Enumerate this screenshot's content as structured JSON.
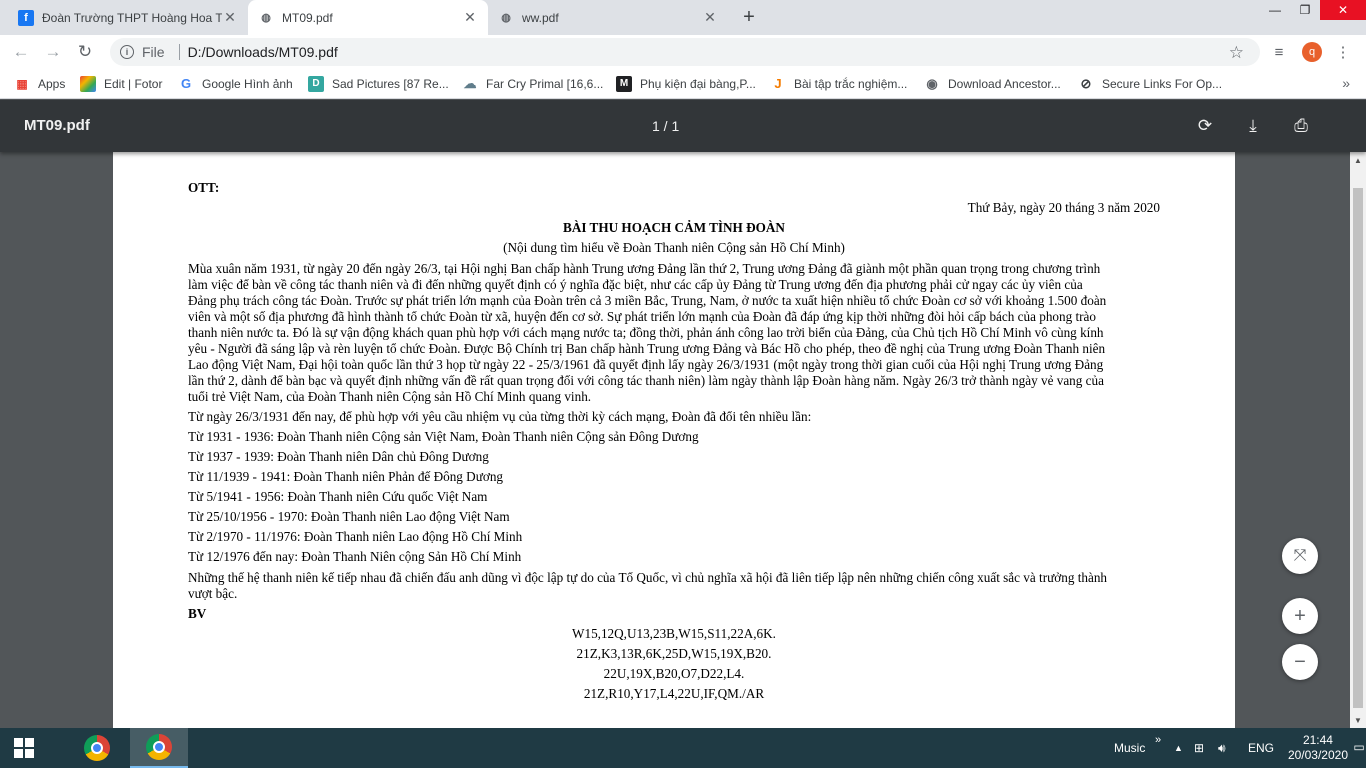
{
  "browser": {
    "tabs": [
      {
        "title": "Đoàn Trường THPT Hoàng Hoa Thám",
        "icon": "facebook-icon",
        "active": false
      },
      {
        "title": "MT09.pdf",
        "icon": "globe-icon",
        "active": true
      },
      {
        "title": "ww.pdf",
        "icon": "globe-icon",
        "active": false
      }
    ],
    "new_tab": "+",
    "window_controls": {
      "minimize": "—",
      "restore": "❐",
      "close": "✕"
    },
    "address": {
      "scheme": "File",
      "url": "D:/Downloads/MT09.pdf"
    },
    "profile_initial": "q"
  },
  "bookmarks": [
    {
      "label": "Apps",
      "icon": "apps-grid-icon",
      "color": "#e94235"
    },
    {
      "label": "Edit | Fotor",
      "icon": "fotor-icon",
      "color": "#f4b400"
    },
    {
      "label": "Google Hình ảnh",
      "icon": "google-icon",
      "color": "#4285f4"
    },
    {
      "label": "Sad Pictures [87 Re...",
      "icon": "bookmark-d-icon",
      "color": "#34a7a0"
    },
    {
      "label": "Far Cry Primal [16,6...",
      "icon": "bookmark-cloud-icon",
      "color": "#607d8b"
    },
    {
      "label": "Phụ kiện đại bàng,P...",
      "icon": "bookmark-m-icon",
      "color": "#202124"
    },
    {
      "label": "Bài tập trắc nghiệm...",
      "icon": "bookmark-j-icon",
      "color": "#f57c00"
    },
    {
      "label": "Download Ancestor...",
      "icon": "bookmark-globe-icon",
      "color": "#5f6368"
    },
    {
      "label": "Secure Links For Op...",
      "icon": "bookmark-link-icon",
      "color": "#3c4043"
    }
  ],
  "pdf": {
    "title": "MT09.pdf",
    "page_indicator": "1 / 1",
    "content": {
      "ott": "OTT:",
      "date": "Thứ Bảy, ngày 20 tháng 3 năm 2020",
      "heading": "BÀI THU HOẠCH CẢM TÌNH ĐOÀN",
      "subheading": "(Nội dung tìm hiểu về Đoàn Thanh niên Cộng sản Hồ Chí Minh)",
      "para1": [
        "Mùa xuân năm 1931, từ ngày 20 đến ngày 26/3, tại Hội nghị Ban chấp hành Trung ương Đảng lần thứ 2, Trung ương Đảng đã giành một phần quan trọng trong chương trình",
        "làm việc để bàn về công tác thanh niên và đi đến những quyết định có ý nghĩa đặc biệt, như các cấp ủy Đảng từ Trung ương đến địa phương phải cử ngay các ủy viên của",
        "Đảng phụ trách công tác Đoàn. Trước sự phát triển lớn mạnh của Đoàn trên cả 3 miền Bắc, Trung, Nam, ở nước ta xuất hiện nhiều tổ chức Đoàn cơ sở với khoảng 1.500 đoàn",
        "viên và một số địa phương đã hình thành tổ chức Đoàn từ xã, huyện đến cơ sở. Sự phát triển lớn mạnh của Đoàn đã đáp ứng kịp thời những đòi hỏi cấp bách của phong trào",
        "thanh niên nước ta. Đó là sự vận động khách quan phù hợp với cách mạng nước ta; đồng thời, phản ánh công lao trời biển của Đảng, của Chủ tịch Hồ Chí Minh vô cùng kính",
        "yêu - Người đã sáng lập và rèn luyện tổ chức Đoàn. Được Bộ Chính trị Ban chấp hành Trung ương Đảng và Bác Hồ cho phép, theo đề nghị của Trung ương Đoàn Thanh niên",
        "Lao động Việt Nam, Đại hội toàn quốc lần thứ 3 họp từ ngày 22 - 25/3/1961 đã quyết định lấy ngày 26/3/1931 (một ngày trong thời gian cuối của Hội nghị Trung ương Đảng",
        "lần thứ 2, dành để bàn bạc và quyết định những vấn đề rất quan trọng đối với công tác thanh niên) làm ngày thành lập Đoàn hàng năm. Ngày 26/3 trở thành ngày vẻ vang của",
        "tuổi trẻ Việt Nam, của Đoàn Thanh niên Cộng sản Hồ Chí Minh quang vinh."
      ],
      "para2": "Từ ngày 26/3/1931 đến nay, để phù hợp với yêu cầu nhiệm vụ của từng thời kỳ cách mạng, Đoàn đã đổi tên nhiều lần:",
      "names": [
        "Từ 1931 - 1936: Đoàn Thanh niên Cộng sản Việt Nam, Đoàn Thanh niên Cộng sản Đông Dương",
        "Từ 1937 - 1939: Đoàn Thanh niên Dân chủ Đông Dương",
        "Từ 11/1939 - 1941: Đoàn Thanh niên Phản đế Đông Dương",
        "Từ 5/1941 - 1956: Đoàn Thanh niên Cứu quốc Việt Nam",
        "Từ 25/10/1956 - 1970: Đoàn Thanh niên Lao động Việt Nam",
        "Từ 2/1970 - 11/1976: Đoàn Thanh niên Lao động Hồ Chí Minh",
        "Từ 12/1976 đến nay: Đoàn Thanh Niên cộng Sản Hồ Chí Minh"
      ],
      "para3": [
        "Những thế hệ thanh niên kế tiếp nhau đã chiến đấu anh dũng vì độc lập tự do của Tổ Quốc, vì chủ nghĩa xã hội đã liên tiếp lập nên những chiến công xuất sắc và trưởng thành",
        "vượt bậc."
      ],
      "bv": "BV",
      "codes": [
        "W15,12Q,U13,23B,W15,S11,22A,6K.",
        "21Z,K3,13R,6K,25D,W15,19X,B20.",
        "22U,19X,B20,O7,D22,L4.",
        "21Z,R10,Y17,L4,22U,IF,QM./AR"
      ]
    }
  },
  "taskbar": {
    "tray_label": "Music",
    "language": "ENG",
    "time": "21:44",
    "date": "20/03/2020"
  }
}
